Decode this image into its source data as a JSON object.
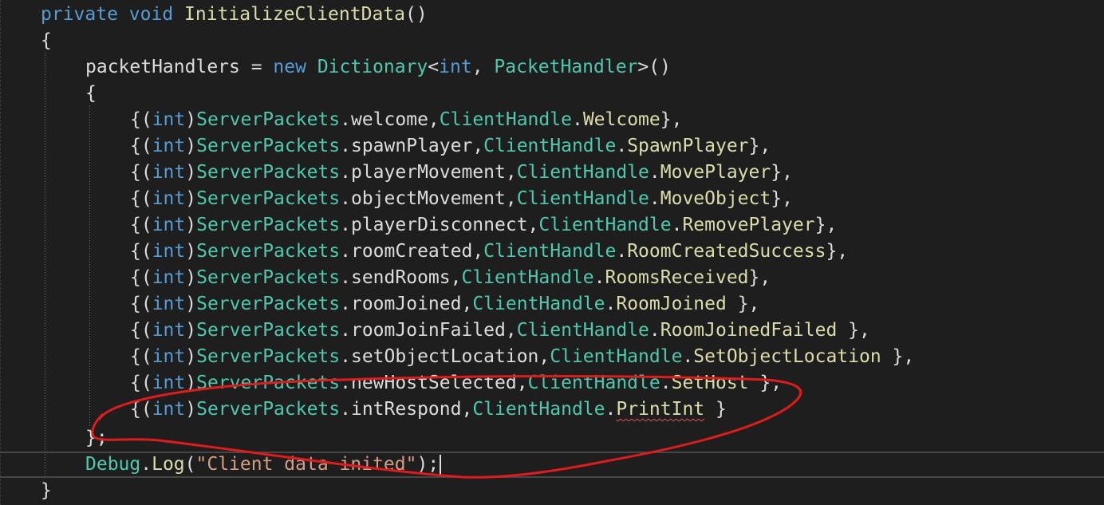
{
  "colors": {
    "background": "#1e1e1e",
    "keyword": "#569cd6",
    "type": "#4ec9b0",
    "method": "#dcdcaa",
    "string": "#d69d85",
    "plain": "#dcdcdc",
    "annotation": "#e01b1b"
  },
  "code": {
    "l1": {
      "kw1": "private",
      "kw2": "void",
      "fn": "InitializeClientData",
      "rest": "()"
    },
    "l2": "{",
    "l3": {
      "a": "packetHandlers = ",
      "kw": "new",
      "ty1": "Dictionary",
      "b": "<",
      "kw2": "int",
      "c": ", ",
      "ty2": "PacketHandler",
      "d": ">()"
    },
    "l4": "{",
    "entries": [
      {
        "field": "welcome",
        "method": "Welcome",
        "tail": "},"
      },
      {
        "field": "spawnPlayer",
        "method": "SpawnPlayer",
        "tail": "},"
      },
      {
        "field": "playerMovement",
        "method": "MovePlayer",
        "tail": "},"
      },
      {
        "field": "objectMovement",
        "method": "MoveObject",
        "tail": "},"
      },
      {
        "field": "playerDisconnect",
        "method": "RemovePlayer",
        "tail": "},"
      },
      {
        "field": "roomCreated",
        "method": "RoomCreatedSuccess",
        "tail": "},"
      },
      {
        "field": "sendRooms",
        "method": "RoomsReceived",
        "tail": "},"
      },
      {
        "field": "roomJoined",
        "method": "RoomJoined",
        "tail": " },"
      },
      {
        "field": "roomJoinFailed",
        "method": "RoomJoinedFailed",
        "tail": " },"
      },
      {
        "field": "setObjectLocation",
        "method": "SetObjectLocation",
        "tail": " },"
      },
      {
        "field": "newHostSelected",
        "method": "SetHost",
        "tail": " },"
      },
      {
        "field": "intRespond",
        "method": "PrintInt",
        "tail": " }"
      }
    ],
    "entry_parts": {
      "open": "{(",
      "kw": "int",
      "close": ")",
      "enum": "ServerPackets",
      "dot": ".",
      "comma": ",",
      "cls": "ClientHandle"
    },
    "l17": "};",
    "l18": {
      "ty": "Debug",
      "dot": ".",
      "fn": "Log",
      "open": "(",
      "str": "\"Client data inited\"",
      "close": ");"
    },
    "l19": "}"
  }
}
